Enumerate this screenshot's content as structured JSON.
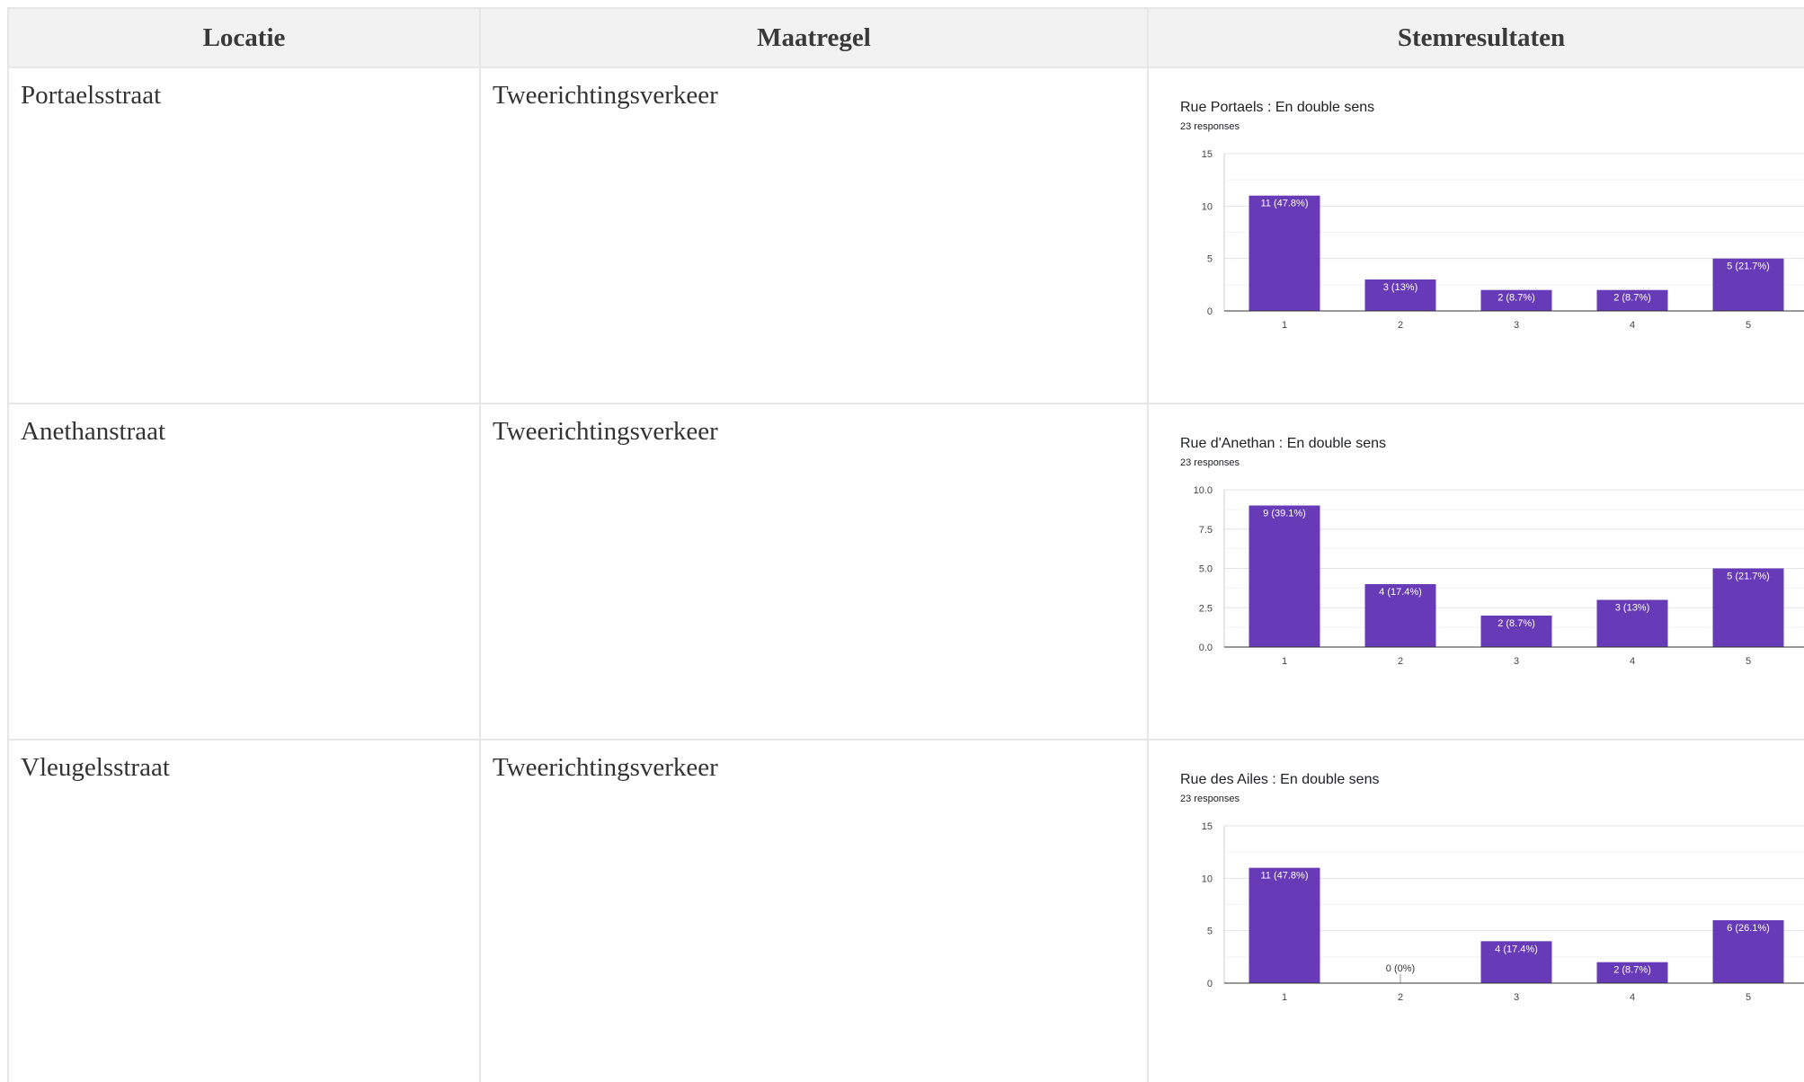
{
  "table": {
    "headers": {
      "location": "Locatie",
      "measure": "Maatregel",
      "results": "Stemresultaten"
    },
    "rows": [
      {
        "location": "Portaelsstraat",
        "measure": "Tweerichtingsverkeer"
      },
      {
        "location": "Anethanstraat",
        "measure": "Tweerichtingsverkeer"
      },
      {
        "location": "Vleugelsstraat",
        "measure": "Tweerichtingsverkeer"
      }
    ]
  },
  "colors": {
    "bar": "#673ab7",
    "header_bg": "#f2f2f2",
    "border": "#e6e6e6"
  },
  "chart_data": [
    {
      "type": "bar",
      "title": "Rue Portaels : En double sens",
      "subtitle": "23 responses",
      "categories": [
        "1",
        "2",
        "3",
        "4",
        "5"
      ],
      "values": [
        11,
        3,
        2,
        2,
        5
      ],
      "labels": [
        "11 (47.8%)",
        "3 (13%)",
        "2 (8.7%)",
        "2 (8.7%)",
        "5 (21.7%)"
      ],
      "ylim": [
        0,
        15
      ],
      "yticks": [
        "0",
        "5",
        "10",
        "15"
      ],
      "ytick_values": [
        0,
        5,
        10,
        15
      ],
      "grid": true
    },
    {
      "type": "bar",
      "title": "Rue d'Anethan : En double sens",
      "subtitle": "23 responses",
      "categories": [
        "1",
        "2",
        "3",
        "4",
        "5"
      ],
      "values": [
        9,
        4,
        2,
        3,
        5
      ],
      "labels": [
        "9 (39.1%)",
        "4 (17.4%)",
        "2 (8.7%)",
        "3 (13%)",
        "5 (21.7%)"
      ],
      "ylim": [
        0,
        10
      ],
      "yticks": [
        "0.0",
        "2.5",
        "5.0",
        "7.5",
        "10.0"
      ],
      "ytick_values": [
        0,
        2.5,
        5,
        7.5,
        10
      ],
      "grid": true
    },
    {
      "type": "bar",
      "title": "Rue des Ailes : En double sens",
      "subtitle": "23 responses",
      "categories": [
        "1",
        "2",
        "3",
        "4",
        "5"
      ],
      "values": [
        11,
        0,
        4,
        2,
        6
      ],
      "labels": [
        "11 (47.8%)",
        "0 (0%)",
        "4 (17.4%)",
        "2 (8.7%)",
        "6 (26.1%)"
      ],
      "ylim": [
        0,
        15
      ],
      "yticks": [
        "0",
        "5",
        "10",
        "15"
      ],
      "ytick_values": [
        0,
        5,
        10,
        15
      ],
      "grid": true
    }
  ]
}
